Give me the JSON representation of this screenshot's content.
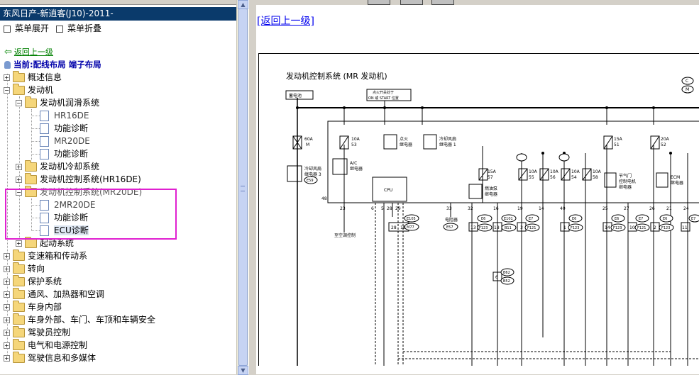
{
  "window": {
    "title": "东风日产-新逍客(J10)-2011-"
  },
  "menu": {
    "expand_all": "菜单展开",
    "collapse_all": "菜单折叠"
  },
  "nav": {
    "back_label": "返回上一级",
    "current_label": "当前:配线布局 端子布局"
  },
  "tree": {
    "overview": "概述信息",
    "engine": "发动机",
    "lubrication": "发动机润滑系统",
    "hr16de": "HR16DE",
    "func_diag_1": "功能诊断",
    "mr20de": "MR20DE",
    "func_diag_2": "功能诊断",
    "cooling": "发动机冷却系统",
    "control_hr16de": "发动机控制系统(HR16DE)",
    "control_mr20de": "发动机控制系统(MR20DE)",
    "mr20de_2": "2MR20DE",
    "func_diag_3": "功能诊断",
    "ecu_diag": "ECU诊断",
    "starting": "起动系统",
    "transmission": "变速箱和传动系",
    "steering": "转向",
    "protection": "保护系统",
    "hvac": "通风、加热器和空调",
    "interior": "车身内部",
    "exterior": "车身外部、车门、车顶和车辆安全",
    "driver_control": "驾驶员控制",
    "electrical": "电气和电源控制",
    "driver_info": "驾驶信息和多媒体"
  },
  "right": {
    "back_link": "[返回上一级]"
  },
  "diagram": {
    "title": "发动机控制系统 (MR 发动机)",
    "battery": "蓄电池",
    "ignition_switch_1": "点火开关处于",
    "ignition_switch_2": "ON 或 START 位置",
    "legend_c": "C",
    "legend_m": "M",
    "fuse_60a": "60A",
    "fuse_60a_id": "M",
    "fuse_10a_53": "10A",
    "fuse_53": "53",
    "relay_ignition": "点火",
    "relay_ignition_2": "继电器",
    "relay_fan1": "冷却风扇",
    "relay_fan1_2": "继电器 1",
    "relay_fan3": "冷却风扇",
    "relay_fan3_2": "继电器 3",
    "conn_e59": "E59",
    "relay_ac": "A/C",
    "relay_ac_2": "继电器",
    "cpu": "CPU",
    "fuse_15a_57": "15A",
    "fuse_57": "57",
    "relay_fuel": "燃油泵",
    "relay_fuel_2": "继电器",
    "fuse_10a_55": "10A",
    "fuse_55": "55",
    "fuse_10a_56": "10A",
    "fuse_56": "56",
    "fuse_10a_54": "10A",
    "fuse_54": "54",
    "fuse_10a_58": "10A",
    "fuse_58": "58",
    "fuse_15a_51": "15A",
    "fuse_51": "51",
    "relay_throttle": "节气门",
    "relay_throttle_2": "控制电机",
    "relay_throttle_3": "继电器",
    "fuse_20a_52": "20A",
    "fuse_52": "52",
    "relay_ecm": "ECM",
    "relay_ecm_2": "继电器",
    "to_ac": "至空调控制",
    "pin_48": "48",
    "pin_23": "23",
    "pin_6": "6",
    "pin_5": "5",
    "pin_28": "28",
    "pin_29": "29",
    "pin_33": "33",
    "pin_32": "32",
    "pin_16": "16",
    "pin_19": "19",
    "pin_14": "14",
    "pin_40": "40",
    "pin_25": "25",
    "pin_27": "27",
    "pin_26": "26",
    "pin_21": "21",
    "pin_24": "24",
    "conn_e105": "E105",
    "conn_m77": "M77",
    "pin_28b": "28",
    "pin_18": "18",
    "resistor": "电阻器",
    "conn_e57": "E57",
    "conn_e6_1": "E6",
    "conn_f123_1": "F123",
    "pin_13": "13",
    "conn_e101": "E101",
    "conn_b11": "B11",
    "pin_18b": "18",
    "conn_e7_1": "E7",
    "conn_f121_1": "F121",
    "pin_3": "3",
    "conn_e6_2": "E6",
    "conn_f123_2": "F123",
    "pin_1": "1",
    "conn_e6_3": "E6",
    "conn_f123_3": "F123",
    "pin_14b": "14",
    "conn_e7_2": "E7",
    "conn_f121_2": "F121",
    "pin_10": "10",
    "conn_e6_4": "E6",
    "conn_f123_4": "F123",
    "pin_2": "2",
    "conn_e7_3": "E7",
    "pin_11": "11",
    "conn_b62": "B62",
    "conn_b52": "B52",
    "pin_6b": "6"
  }
}
